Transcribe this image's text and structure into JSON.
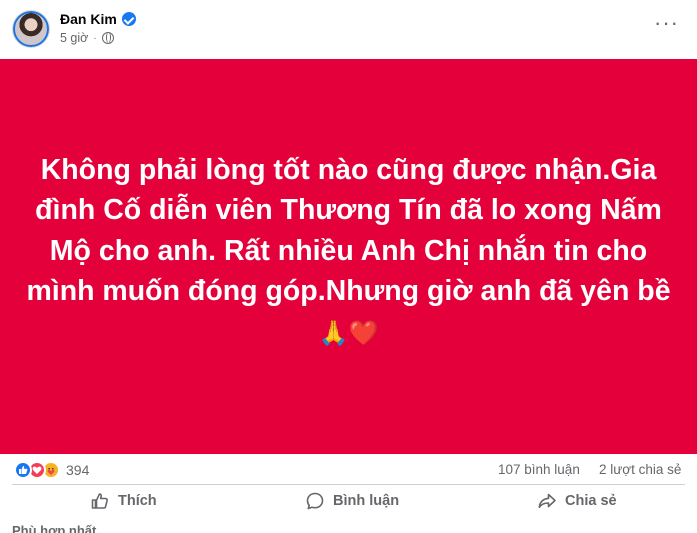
{
  "post": {
    "author": "Đan Kim",
    "time": "5 giờ",
    "more_icon": "ellipsis-icon",
    "close_icon": "close-icon",
    "banner_color": "#e4003a",
    "banner_text": "Không phải lòng tốt nào cũng được nhận.Gia đình Cố diễn viên Thương Tín đã lo xong Nấm Mộ cho anh. Rất nhiều Anh Chị nhắn tin cho mình muốn đóng góp.Nhưng giờ anh đã yên bề",
    "banner_emojis": "🙏❤️"
  },
  "stats": {
    "reaction_count": "394",
    "comments": "107 bình luận",
    "shares": "2 lượt chia sẻ"
  },
  "actions": {
    "like": "Thích",
    "comment": "Bình luận",
    "share": "Chia sẻ"
  },
  "comments_section": {
    "sort_label": "Phù hợp nhất"
  },
  "colors": {
    "accent": "#1877f2",
    "secondary_text": "#65676b"
  }
}
